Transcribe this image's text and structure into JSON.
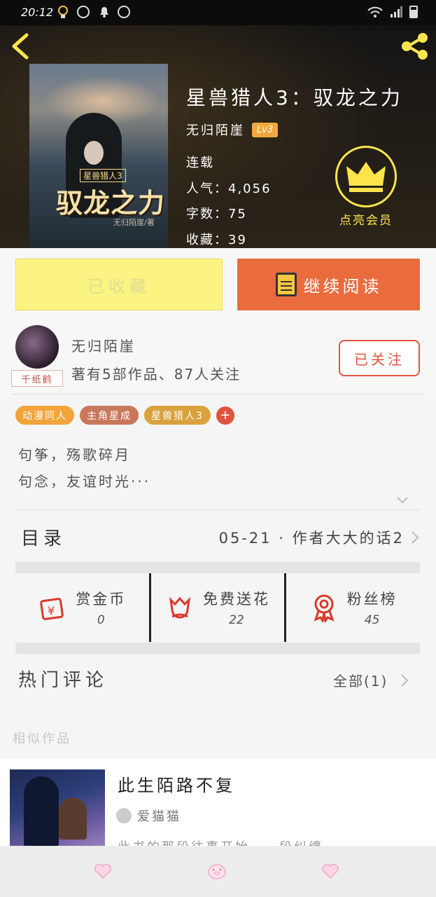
{
  "status": {
    "time": "20:12"
  },
  "book": {
    "title": "星兽猎人3：驭龙之力",
    "author": "无归陌崖",
    "level": "Lv3",
    "state": "连载",
    "popularity": "人气：4,056",
    "words": "字数：75",
    "favorites": "收藏：39",
    "cover": {
      "series": "星兽猎人3",
      "title": "驭龙之力",
      "author": "无归陌崖/著"
    }
  },
  "vip": {
    "label": "点亮会员"
  },
  "actions": {
    "collected": "已收藏",
    "continue": "继续阅读"
  },
  "author_card": {
    "name": "无归陌崖",
    "stats": "著有5部作品、87人关注",
    "tag": "千纸鹤",
    "follow": "已关注"
  },
  "tags": [
    {
      "label": "动漫同人",
      "color": "#f1a43a"
    },
    {
      "label": "主角星成",
      "color": "#c9775a"
    },
    {
      "label": "星兽猎人3",
      "color": "#d9a23d"
    }
  ],
  "intro": {
    "line1": "句筝，殇歌碎月",
    "line2": "句念，友谊时光···"
  },
  "toc": {
    "label": "目录",
    "latest": "05-21 · 作者大大的话2"
  },
  "stats": [
    {
      "label": "赏金币",
      "value": "0",
      "icon": "reward-coin-icon"
    },
    {
      "label": "免费送花",
      "value": "22",
      "icon": "flower-icon"
    },
    {
      "label": "粉丝榜",
      "value": "45",
      "icon": "medal-icon"
    }
  ],
  "comments": {
    "title": "热门评论",
    "all": "全部(1)"
  },
  "similar": {
    "heading": "相似作品",
    "title": "此生陌路不复",
    "author": "爱猫猫",
    "desc": "此书的那段往事开始，一段纠缠"
  },
  "colors": {
    "accent": "#ea6b3d",
    "collect": "#fbf482",
    "vip": "#ffe54c"
  }
}
